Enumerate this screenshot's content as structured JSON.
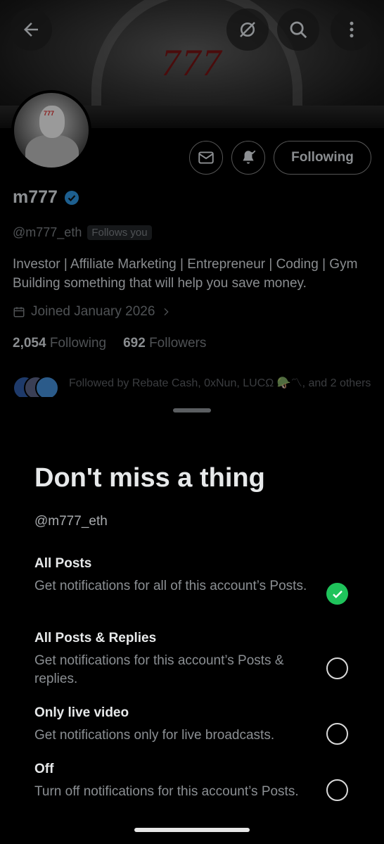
{
  "banner": {
    "text": "777"
  },
  "avatar": {
    "tag": "777"
  },
  "profile": {
    "display_name": "m777",
    "verified": true,
    "handle": "@m777_eth",
    "follows_you": "Follows you",
    "bio": "Investor | Affiliate Marketing | Entrepreneur | Coding | Gym Building something that will help you save money.",
    "joined": "Joined January 2026",
    "following_count": "2,054",
    "following_label": "Following",
    "followers_count": "692",
    "followers_label": "Followers",
    "followed_by": "Followed by Rebate Cash, 0xNun, LUCΩ 🪖〽, and 2 others",
    "follow_button": "Following"
  },
  "top_icons": [
    "back-arrow-icon",
    "grok-icon",
    "search-icon",
    "more-vertical-icon"
  ],
  "sheet": {
    "title": "Don't miss a thing",
    "handle": "@m777_eth",
    "options": [
      {
        "title": "All Posts",
        "desc": "Get notifications for all of this account’s Posts.",
        "selected": true
      },
      {
        "title": "All Posts & Replies",
        "desc": "Get notifications for this account’s Posts & replies.",
        "selected": false
      },
      {
        "title": "Only live video",
        "desc": "Get notifications only for live broadcasts.",
        "selected": false
      },
      {
        "title": "Off",
        "desc": "Turn off notifications for this account’s Posts.",
        "selected": false
      }
    ]
  },
  "colors": {
    "accent_green": "#1fc35b",
    "verified_blue": "#1d9bf0",
    "background": "#000000"
  }
}
